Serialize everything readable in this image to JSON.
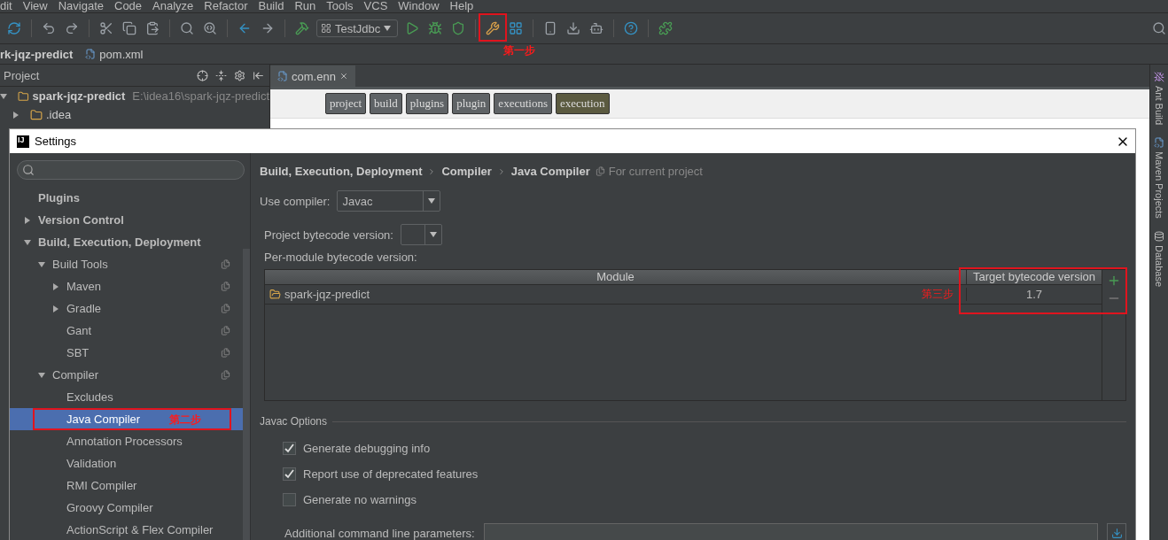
{
  "menu_bar": [
    "dit",
    "View",
    "Navigate",
    "Code",
    "Analyze",
    "Refactor",
    "Build",
    "Run",
    "Tools",
    "VCS",
    "Window",
    "Help"
  ],
  "toolbar": {
    "run_config": "TestJdbc",
    "annotation": "第一步"
  },
  "navigation_bar": [
    "rk-jqz-predict",
    "pom.xml"
  ],
  "project_panel": {
    "title": "Project",
    "tree": [
      {
        "label": "spark-jqz-predict",
        "path": "E:\\idea16\\spark-jqz-predict",
        "expanded": true,
        "children": [
          {
            "label": ".idea",
            "expanded": false
          }
        ]
      }
    ]
  },
  "editor": {
    "tabs": [
      {
        "label": "com.enn",
        "selected": true
      }
    ],
    "breadcrumbs": [
      {
        "label": "project",
        "selected": false
      },
      {
        "label": "build",
        "selected": false
      },
      {
        "label": "plugins",
        "selected": false
      },
      {
        "label": "plugin",
        "selected": false
      },
      {
        "label": "executions",
        "selected": false
      },
      {
        "label": "execution",
        "selected": true
      }
    ]
  },
  "side_tools": [
    "Ant Build",
    "Maven Projects",
    "Database"
  ],
  "settings_dialog": {
    "logo": "IJ",
    "title": "Settings",
    "tree": [
      {
        "label": "Plugins",
        "selected": false
      },
      {
        "label": "Version Control",
        "expanded": false,
        "selected": false
      },
      {
        "label": "Build, Execution, Deployment",
        "expanded": true,
        "selected": false,
        "children": [
          {
            "label": "Build Tools",
            "expanded": true,
            "selected": false,
            "project_level": true,
            "children": [
              {
                "label": "Maven",
                "expanded": false,
                "selected": false,
                "project_level": true
              },
              {
                "label": "Gradle",
                "expanded": false,
                "selected": false,
                "project_level": true
              },
              {
                "label": "Gant",
                "selected": false,
                "project_level": true
              },
              {
                "label": "SBT",
                "selected": false,
                "project_level": true
              }
            ]
          },
          {
            "label": "Compiler",
            "expanded": true,
            "selected": false,
            "project_level": true,
            "children": [
              {
                "label": "Excludes",
                "selected": false
              },
              {
                "label": "Java Compiler",
                "selected": true,
                "annotation": "第二步"
              },
              {
                "label": "Annotation Processors",
                "selected": false
              },
              {
                "label": "Validation",
                "selected": false
              },
              {
                "label": "RMI Compiler",
                "selected": false
              },
              {
                "label": "Groovy Compiler",
                "selected": false
              },
              {
                "label": "ActionScript & Flex Compiler",
                "selected": false
              }
            ]
          }
        ]
      }
    ],
    "breadcrumb": [
      "Build, Execution, Deployment",
      "Compiler",
      "Java Compiler"
    ],
    "scope_note": "For current project",
    "use_compiler": {
      "label": "Use compiler:",
      "value": "Javac"
    },
    "project_bytecode": {
      "label": "Project bytecode version:"
    },
    "per_module_label": "Per-module bytecode version:",
    "table": {
      "columns": [
        "Module",
        "Target bytecode version"
      ],
      "rows": [
        {
          "module": "spark-jqz-predict",
          "target": "1.7"
        }
      ],
      "annotation": "第三步"
    },
    "javac_options": {
      "title": "Javac Options",
      "checkboxes": [
        {
          "label": "Generate debugging info",
          "checked": true
        },
        {
          "label": "Report use of deprecated features",
          "checked": true
        },
        {
          "label": "Generate no warnings",
          "checked": false
        }
      ],
      "params_label": "Additional command line parameters:"
    }
  }
}
